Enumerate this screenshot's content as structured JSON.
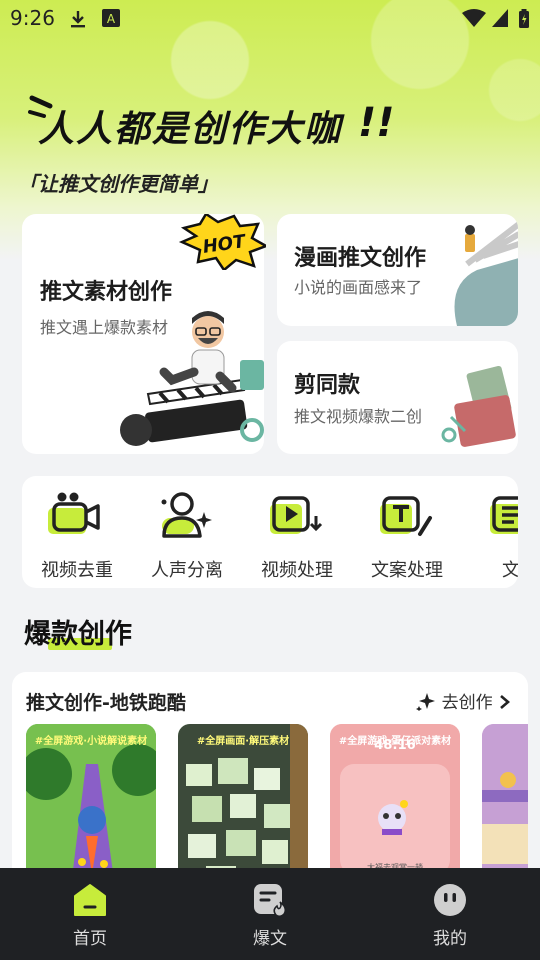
{
  "status_bar": {
    "time": "9:26",
    "icons": [
      "download-icon",
      "font-icon",
      "wifi-icon",
      "signal-icon",
      "battery-icon"
    ]
  },
  "hero": {
    "slogan": "人人都是创作大咖",
    "slogan_suffix": "!!",
    "subslogan": "「让推文创作更简单」"
  },
  "cards": {
    "material": {
      "title": "推文素材创作",
      "desc": "推文遇上爆款素材",
      "badge": "HOT"
    },
    "comic": {
      "title": "漫画推文创作",
      "desc": "小说的画面感来了"
    },
    "same": {
      "title": "剪同款",
      "desc": "推文视频爆款二创"
    }
  },
  "tools": [
    {
      "label": "视频去重",
      "icon": "video-camera-icon"
    },
    {
      "label": "人声分离",
      "icon": "user-sparkle-icon"
    },
    {
      "label": "视频处理",
      "icon": "video-play-icon"
    },
    {
      "label": "文案处理",
      "icon": "text-edit-icon"
    },
    {
      "label": "文章",
      "icon": "article-icon"
    }
  ],
  "section": {
    "title": "爆款创作"
  },
  "feature": {
    "title": "推文创作-地铁跑酷",
    "link": "去创作",
    "thumbs": [
      {
        "caption": "#全屏游戏·小说解说素材"
      },
      {
        "caption": "#全屏画面·解压素材"
      },
      {
        "caption": "#全屏游戏·蛋仔派对素材",
        "timer": "48:16",
        "sub": "大福去观赏一趟"
      },
      {
        "caption": ""
      }
    ]
  },
  "tabbar": [
    {
      "label": "首页",
      "icon": "home-icon",
      "active": true
    },
    {
      "label": "爆文",
      "icon": "article-fire-icon",
      "active": false
    },
    {
      "label": "我的",
      "icon": "profile-face-icon",
      "active": false
    }
  ],
  "colors": {
    "accent": "#c7ec3b",
    "hot": "#ffd51a",
    "tabbar": "#1f2124"
  }
}
